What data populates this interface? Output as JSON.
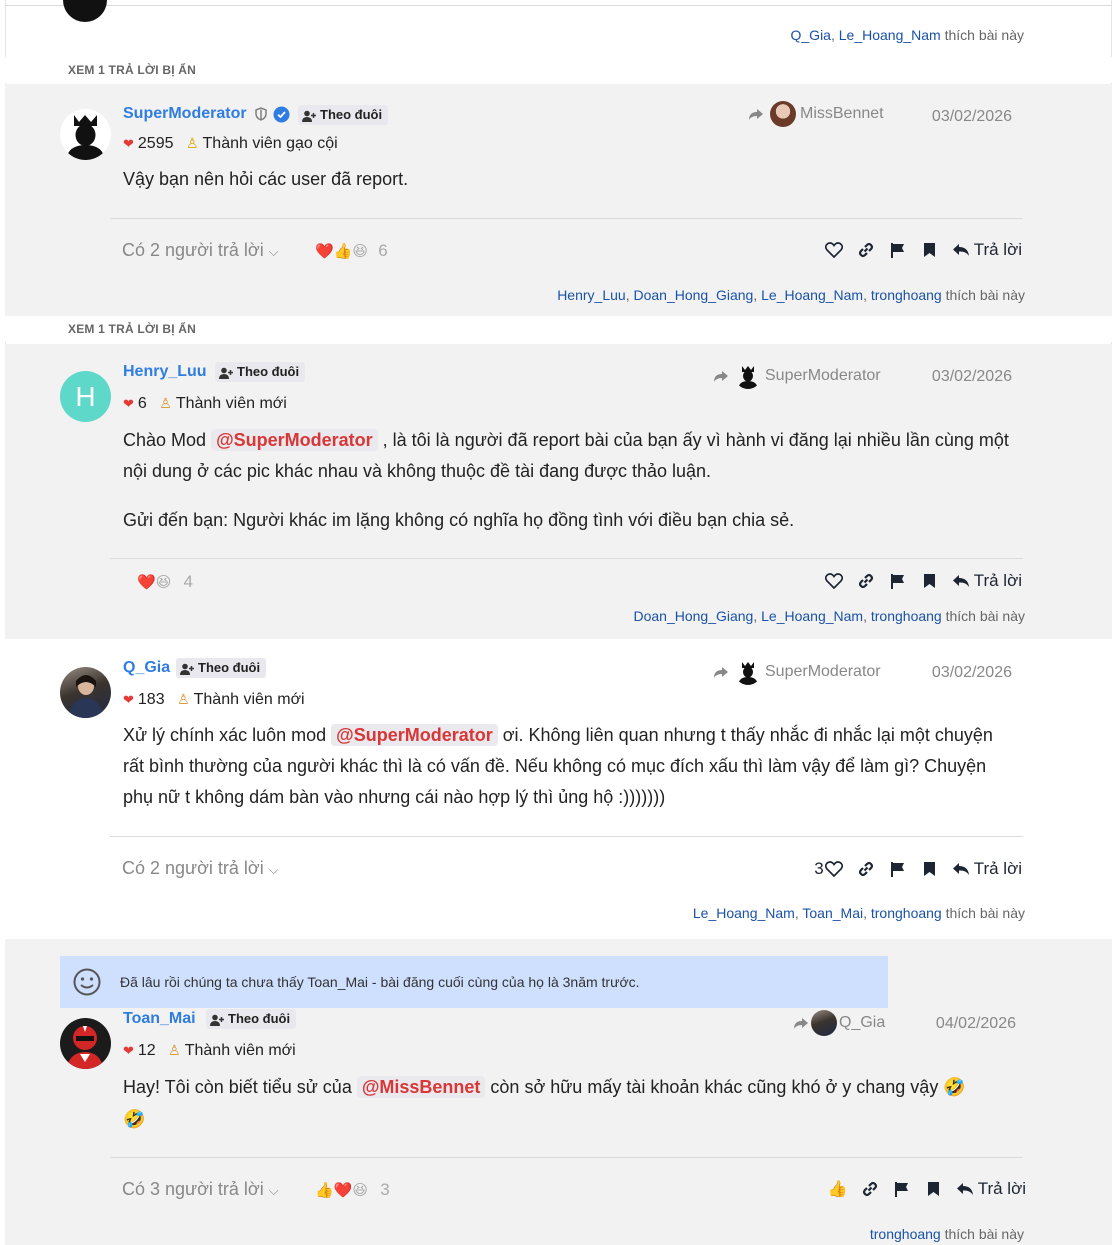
{
  "colors": {
    "accent": "#2f7de1",
    "link": "#1a52a8",
    "mention": "#d93636",
    "notice_bg": "#cfe0ff"
  },
  "top_likes": {
    "users": [
      "Q_Gia",
      "Le_Hoang_Nam"
    ],
    "suffix": "thích bài này"
  },
  "hidden_replies_1": "XEM 1 TRẢ LỜI BỊ ẨN",
  "hidden_replies_2": "XEM 1 TRẢ LỜI BỊ ẨN",
  "posts": [
    {
      "username": "SuperModerator",
      "follow": "Theo đuôi",
      "reputation": "2595",
      "rank": "Thành viên gạo cội",
      "quote_user": "MissBennet",
      "date": "03/02/2026",
      "content": "Vậy bạn nên hỏi các user đã report.",
      "replies": "Có 2 người trả lời",
      "reaction_icons": [
        "heart",
        "thumbs-up",
        "laugh"
      ],
      "reaction_count": "6",
      "reply_label": "Trả lời",
      "likes_users": [
        "Henry_Luu",
        "Doan_Hong_Giang",
        "Le_Hoang_Nam",
        "tronghoang"
      ],
      "likes_suffix": "thích bài này"
    },
    {
      "username": "Henry_Luu",
      "avatar_letter": "H",
      "follow": "Theo đuôi",
      "reputation": "6",
      "rank": "Thành viên mới",
      "quote_user": "SuperModerator",
      "date": "03/02/2026",
      "content_p1_a": "Chào Mod ",
      "mention": "@SuperModerator",
      "content_p1_b": " , là tôi là người đã report bài của bạn ấy vì hành vi đăng lại nhiều lần cùng một nội dung ở các pic khác nhau và không thuộc đề tài đang được thảo luận.",
      "content_p2": "Gửi đến bạn: Người khác im lặng không có nghĩa họ đồng tình với điều bạn chia sẻ.",
      "reaction_icons": [
        "heart",
        "laugh"
      ],
      "reaction_count": "4",
      "reply_label": "Trả lời",
      "likes_users": [
        "Doan_Hong_Giang",
        "Le_Hoang_Nam",
        "tronghoang"
      ],
      "likes_suffix": "thích bài này"
    },
    {
      "username": "Q_Gia",
      "follow": "Theo đuôi",
      "reputation": "183",
      "rank": "Thành viên mới",
      "quote_user": "SuperModerator",
      "date": "03/02/2026",
      "content_a": "Xử lý chính xác luôn mod ",
      "mention": "@SuperModerator",
      "content_b": " ơi. Không liên quan nhưng t thấy nhắc đi nhắc lại một chuyện rất bình thường của người khác thì là có vấn đề. Nếu không có mục đích xấu thì làm vậy để làm gì? Chuyện phụ nữ t không dám bàn vào nhưng cái nào hợp lý thì ủng hộ :)))))))",
      "replies": "Có 2 người trả lời",
      "like_count": "3",
      "reply_label": "Trả lời",
      "likes_users": [
        "Le_Hoang_Nam",
        "Toan_Mai",
        "tronghoang"
      ],
      "likes_suffix": "thích bài này"
    },
    {
      "notice": "Đã lâu rồi chúng ta chưa thấy Toan_Mai - bài đăng cuối cùng của họ là 3năm trước.",
      "username": "Toan_Mai",
      "follow": "Theo đuôi",
      "reputation": "12",
      "rank": "Thành viên mới",
      "quote_user": "Q_Gia",
      "date": "04/02/2026",
      "content_a": "Hay! Tôi còn biết tiểu sử của ",
      "mention": "@MissBennet",
      "content_b": " còn sở hữu mấy tài khoản khác cũng khó ở y chang vậy 🤣",
      "content_c": "🤣",
      "replies": "Có 3 người trả lời",
      "reaction_icons": [
        "thumbs-up",
        "heart",
        "laugh"
      ],
      "reaction_count": "3",
      "reply_label": "Trả lời",
      "likes_users": [
        "tronghoang"
      ],
      "likes_suffix": "thích bài này"
    }
  ]
}
